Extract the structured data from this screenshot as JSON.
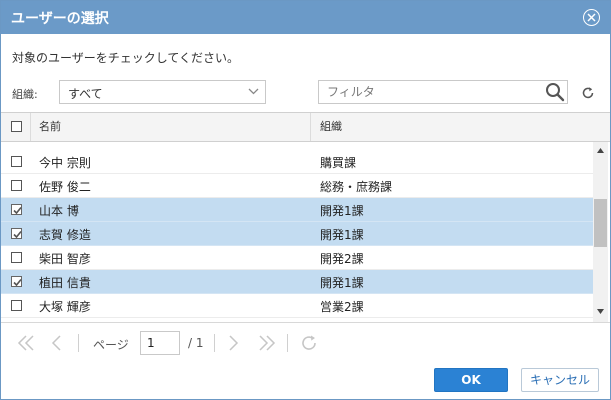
{
  "dialog": {
    "title": "ユーザーの選択",
    "instruction": "対象のユーザーをチェックしてください。"
  },
  "filters": {
    "org_label": "組織:",
    "org_selected": "すべて",
    "filter_placeholder": "フィルタ"
  },
  "grid": {
    "columns": [
      "名前",
      "組織"
    ],
    "rows": [
      {
        "name": "今中 宗則",
        "org": "購買課",
        "checked": false
      },
      {
        "name": "佐野 俊二",
        "org": "総務・庶務課",
        "checked": false
      },
      {
        "name": "山本 博",
        "org": "開発1課",
        "checked": true
      },
      {
        "name": "志賀 修造",
        "org": "開発1課",
        "checked": true
      },
      {
        "name": "柴田 智彦",
        "org": "開発2課",
        "checked": false
      },
      {
        "name": "植田 信貴",
        "org": "開発1課",
        "checked": true
      },
      {
        "name": "大塚 輝彦",
        "org": "営業2課",
        "checked": false
      }
    ]
  },
  "pager": {
    "page_label": "ページ",
    "current_page": "1",
    "total": "/ 1"
  },
  "buttons": {
    "ok": "OK",
    "cancel": "キャンセル"
  },
  "colors": {
    "titlebar": "#6b9ac8",
    "selected_row": "#c3dcf1",
    "ok_button": "#2b82d4"
  }
}
